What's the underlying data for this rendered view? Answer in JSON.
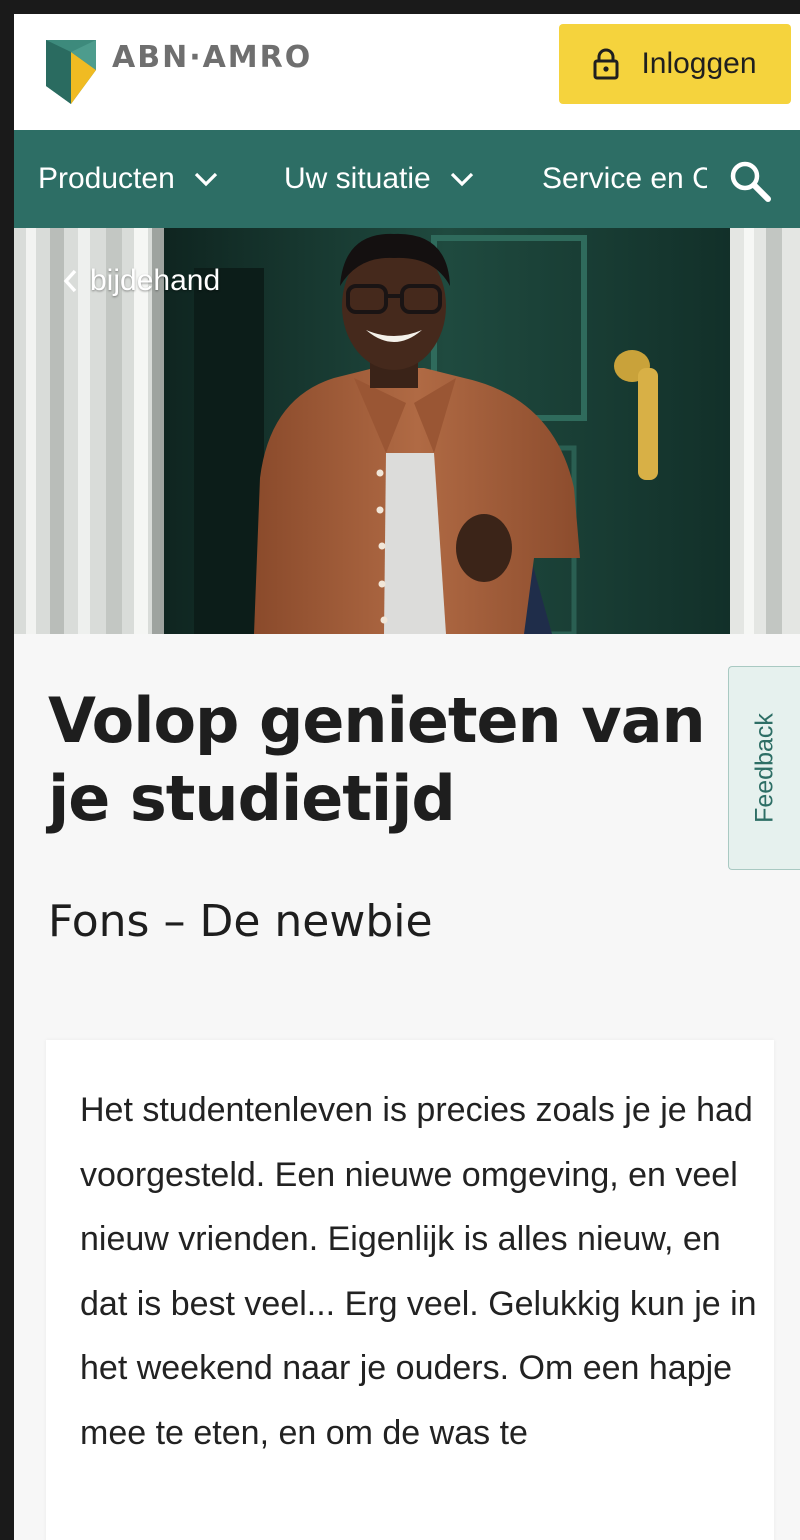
{
  "header": {
    "brand": "ABN·AMRO",
    "login_label": "Inloggen",
    "colors": {
      "brand_green": "#2d6e65",
      "login_yellow": "#f5d33d",
      "logo_gold": "#e8b21c"
    }
  },
  "nav": {
    "items": [
      {
        "label": "Producten",
        "icon": "chevron-down-icon"
      },
      {
        "label": "Uw situatie",
        "icon": "chevron-down-icon"
      },
      {
        "label": "Service en C"
      }
    ],
    "search_icon": "search-icon"
  },
  "hero": {
    "back_label": "bijdehand",
    "image": "smiling student with glasses, rust shirt and backpack in front of a green door"
  },
  "article": {
    "title": "Volop genieten van je studietijd",
    "subtitle": "Fons – De newbie",
    "body": "Het studentenleven is precies zoals je je had voorgesteld. Een nieuwe omgeving, en veel nieuw vrienden. Eigenlijk is alles nieuw, en dat is best veel... Erg veel. Gelukkig kun je in het weekend naar je ouders. Om een hapje mee te eten, en om de was te"
  },
  "feedback": {
    "label": "Feedback"
  }
}
